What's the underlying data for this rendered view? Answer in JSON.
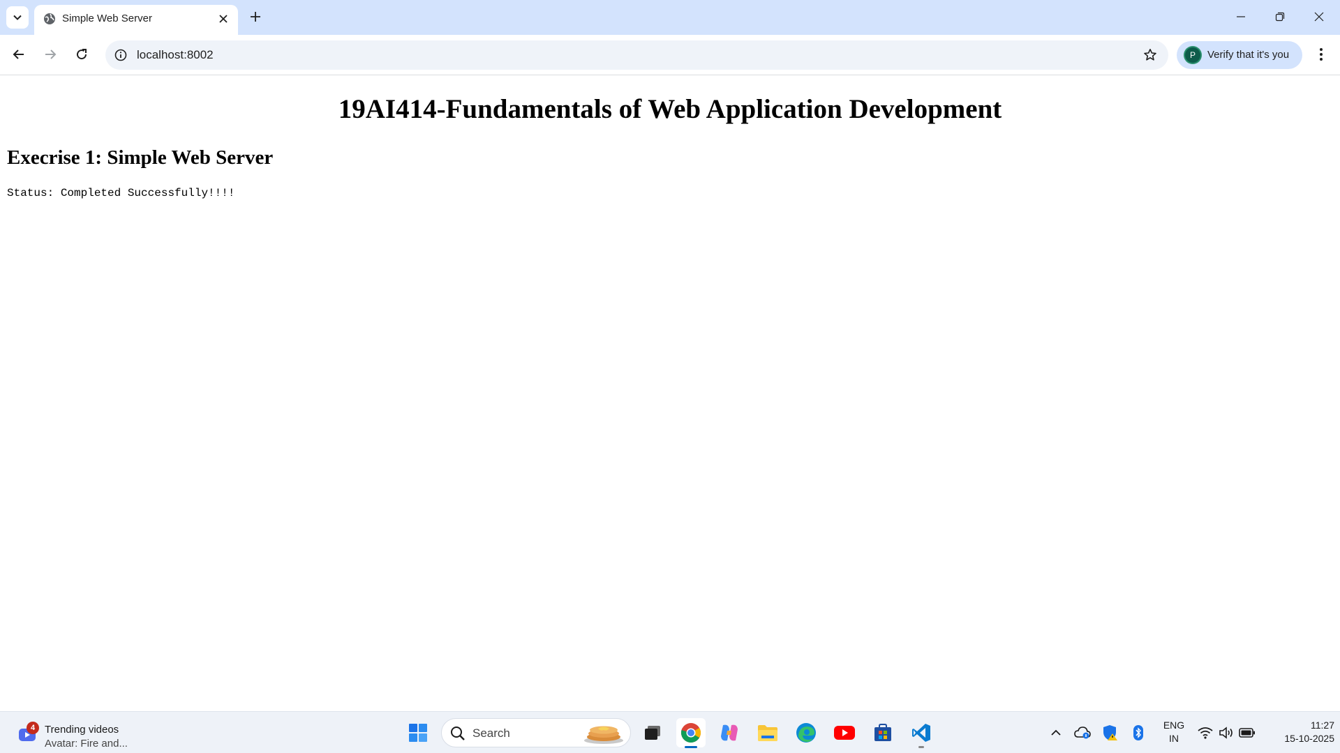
{
  "browser": {
    "tab": {
      "title": "Simple Web Server",
      "favicon": "globe-icon"
    },
    "address": {
      "url": "localhost:8002"
    },
    "profile": {
      "initial": "P",
      "label": "Verify that it's you"
    },
    "colors": {
      "tabstrip": "#d3e3fd",
      "omnibox": "#eff3f9",
      "chip": "#d3e3fd"
    }
  },
  "page": {
    "heading": "19AI414-Fundamentals of Web Application Development",
    "subheading": "Execrise 1: Simple Web Server",
    "status": "Status: Completed Successfully!!!!"
  },
  "taskbar": {
    "widget": {
      "badge": "4",
      "title": "Trending videos",
      "subtitle": "Avatar: Fire and..."
    },
    "search": {
      "label": "Search"
    },
    "apps": [
      "start-icon",
      "task-view-icon",
      "chrome-icon",
      "copilot-icon",
      "file-explorer-icon",
      "edge-icon",
      "youtube-icon",
      "store-icon",
      "vscode-icon"
    ],
    "tray": {
      "lang_top": "ENG",
      "lang_bottom": "IN",
      "time": "11:27",
      "date": "15-10-2025"
    },
    "colors": {
      "accent": "#0067c0",
      "badge": "#c42b1c"
    }
  }
}
